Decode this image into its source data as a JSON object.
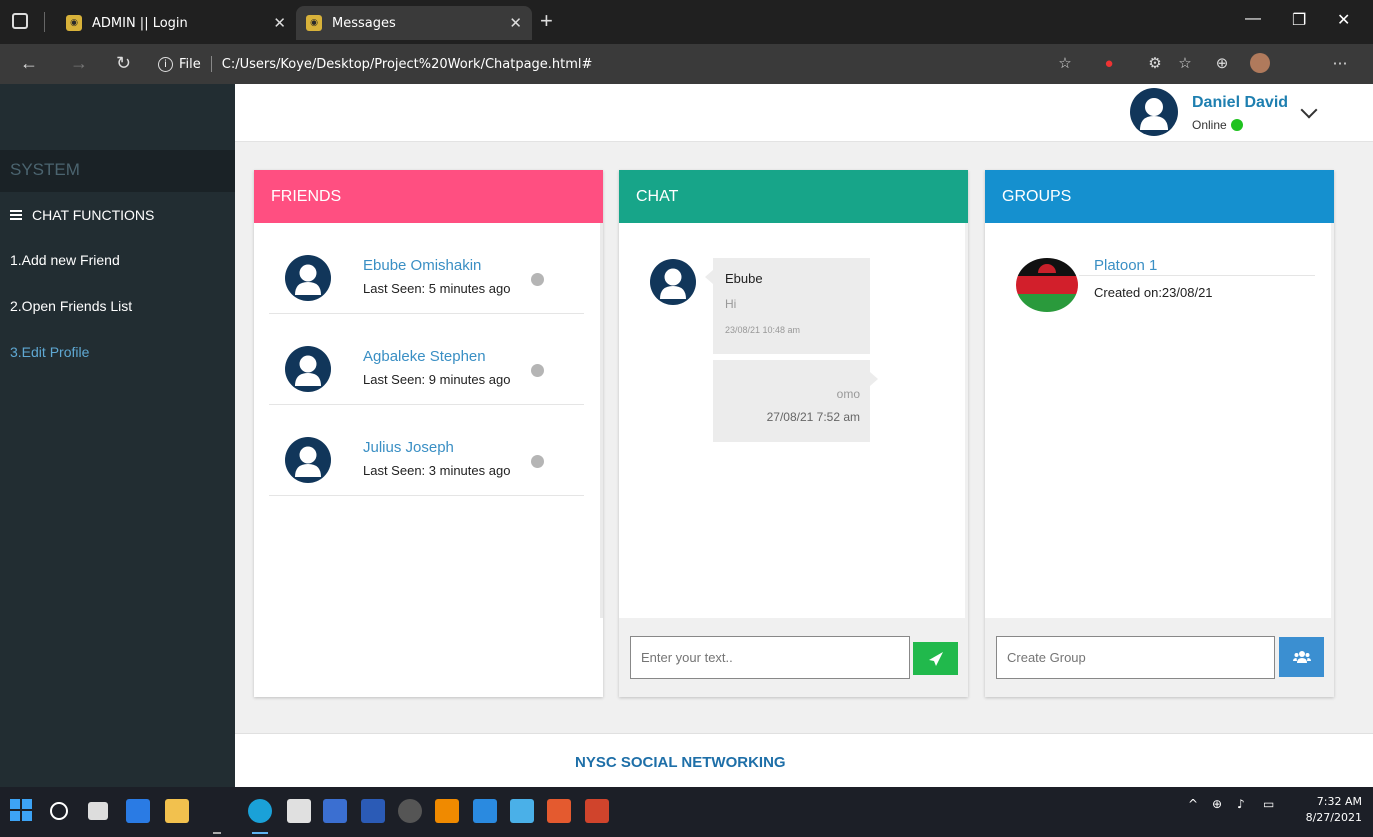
{
  "browser": {
    "tabs": [
      {
        "title": "ADMIN || Login",
        "active": false
      },
      {
        "title": "Messages",
        "active": true
      }
    ],
    "address": {
      "scheme_label": "File",
      "url": "C:/Users/Koye/Desktop/Project%20Work/Chatpage.html#"
    }
  },
  "sidebar": {
    "section_title": "SYSTEM",
    "header": "CHAT FUNCTIONS",
    "items": [
      {
        "label": "1.Add new Friend",
        "active": false
      },
      {
        "label": "2.Open Friends List",
        "active": false
      },
      {
        "label": "3.Edit Profile",
        "active": true
      }
    ]
  },
  "user": {
    "name": "Daniel David",
    "status": "Online",
    "status_color": "#1fc21f"
  },
  "friends": {
    "title": "FRIENDS",
    "color": "#ff4f81",
    "items": [
      {
        "name": "Ebube Omishakin",
        "last_seen": "Last Seen: 5 minutes ago"
      },
      {
        "name": "Agbaleke Stephen",
        "last_seen": "Last Seen: 9 minutes ago"
      },
      {
        "name": "Julius Joseph",
        "last_seen": "Last Seen: 3 minutes ago"
      }
    ]
  },
  "chat": {
    "title": "CHAT",
    "color": "#17a589",
    "messages": [
      {
        "sender": "Ebube",
        "text": "Hi",
        "time": "23/08/21 10:48 am",
        "direction": "in"
      },
      {
        "text": "omo",
        "time": "27/08/21 7:52 am",
        "direction": "out"
      }
    ],
    "input_placeholder": "Enter your text..",
    "send_icon": "paper-plane-icon"
  },
  "groups": {
    "title": "GROUPS",
    "color": "#1590cf",
    "items": [
      {
        "name": "Platoon 1",
        "created": "Created on:23/08/21"
      }
    ],
    "input_placeholder": "Create Group",
    "button_icon": "users-icon"
  },
  "footer": {
    "text": "NYSC SOCIAL NETWORKING"
  },
  "taskbar": {
    "time": "7:32 AM",
    "date": "8/27/2021"
  }
}
